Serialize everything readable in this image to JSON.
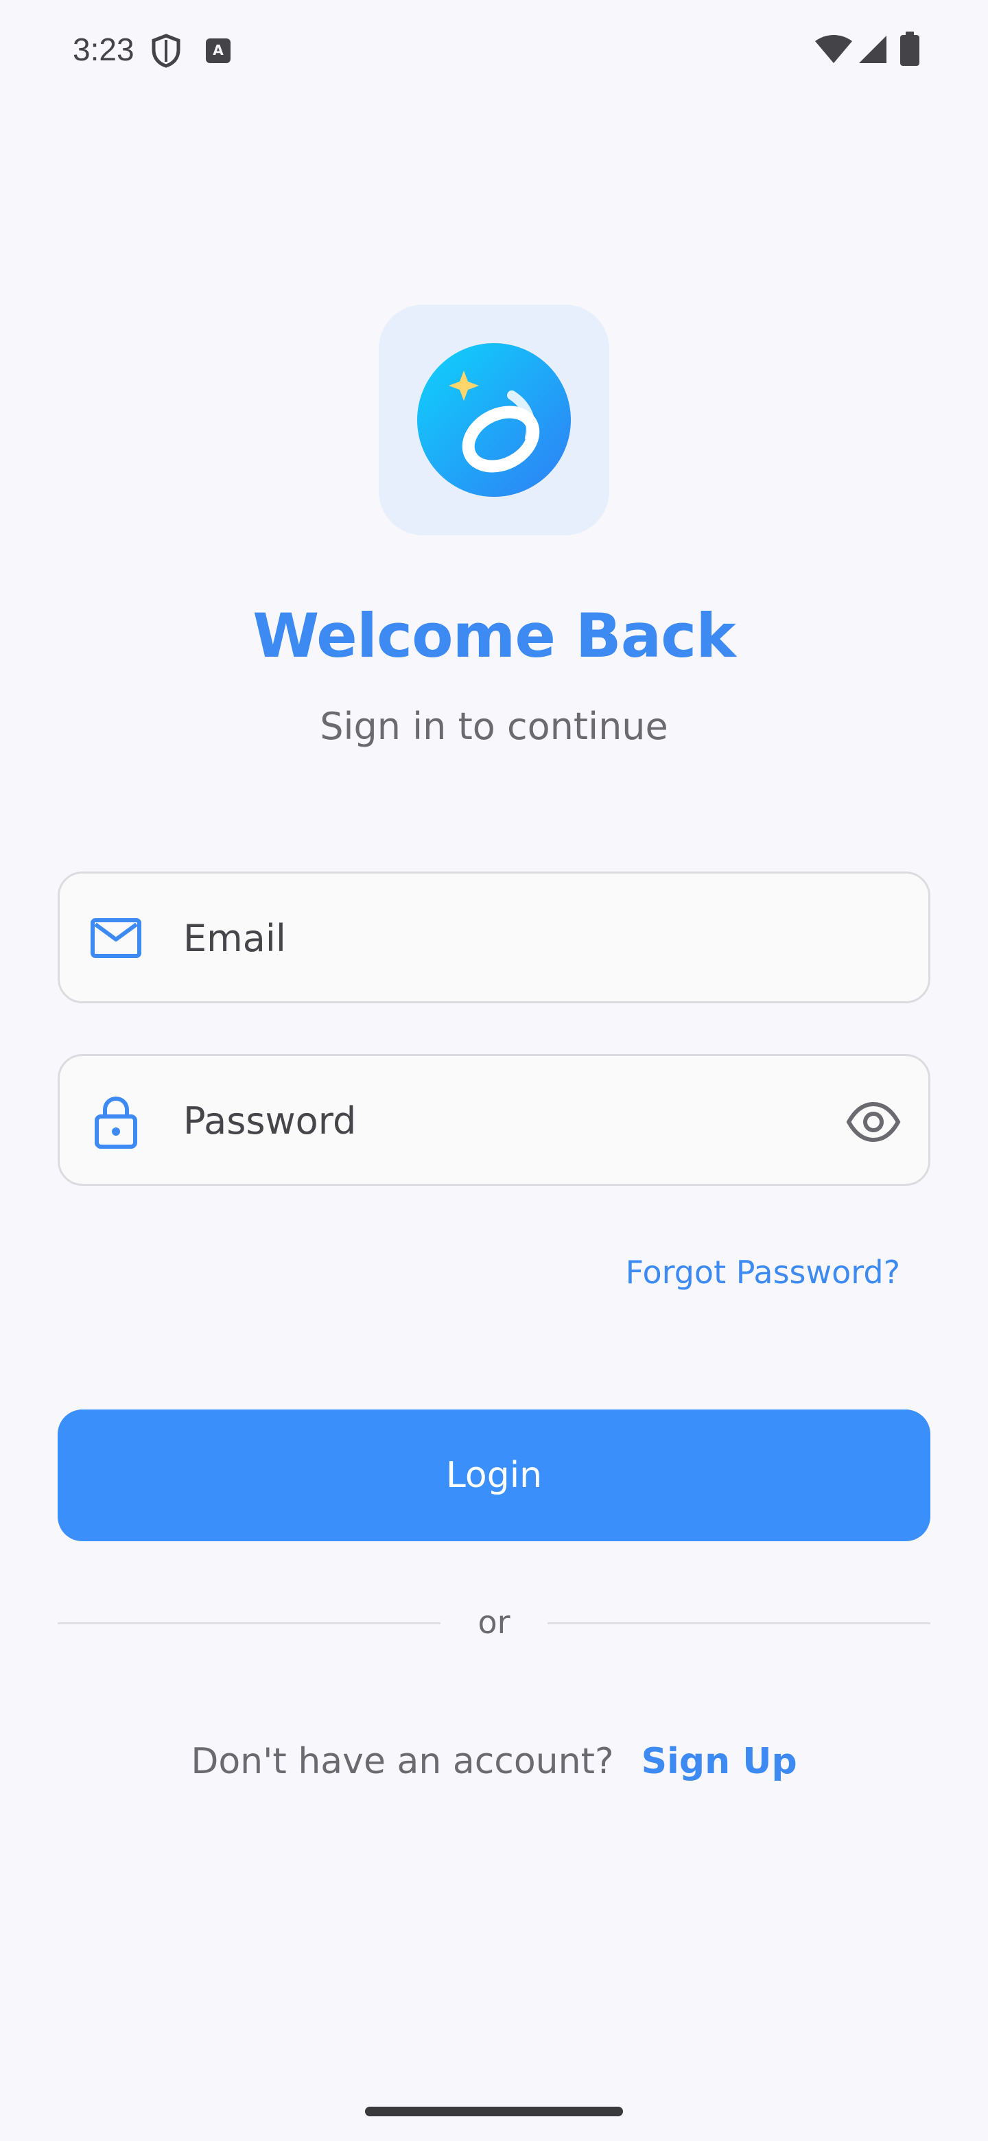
{
  "status_bar": {
    "time": "3:23",
    "icons": [
      "shield-icon",
      "keyboard-a-icon",
      "wifi-icon",
      "cell-signal-icon",
      "battery-icon"
    ]
  },
  "brand": {
    "logo_icon": "app-logo-swirl",
    "primary_color": "#3D8BF2",
    "button_color": "#3A8FFB"
  },
  "header": {
    "title": "Welcome Back",
    "subtitle": "Sign in to continue"
  },
  "form": {
    "email": {
      "value": "",
      "placeholder": "Email",
      "icon": "mail-icon"
    },
    "password": {
      "value": "",
      "placeholder": "Password",
      "icon": "lock-icon",
      "toggle_icon": "eye-icon"
    },
    "forgot_label": "Forgot Password?",
    "login_label": "Login"
  },
  "divider": {
    "label": "or"
  },
  "signup": {
    "prompt": "Don't have an account?",
    "link_label": "Sign Up"
  }
}
